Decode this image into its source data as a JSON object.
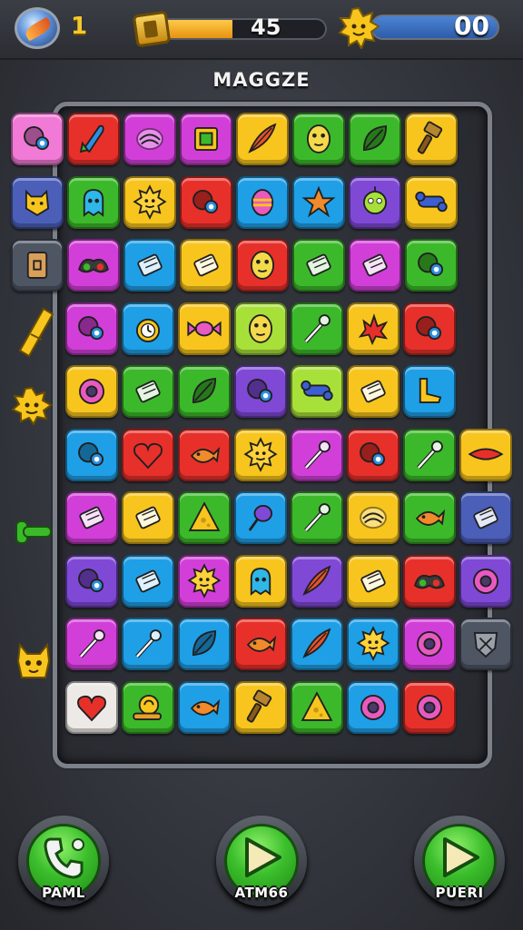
{
  "hud": {
    "level": "1",
    "progress": {
      "value": "45",
      "fill_fraction": 0.45
    },
    "score": "00"
  },
  "title": "MAGGZE",
  "colors": {
    "red": "#e8302b",
    "magenta": "#d23fd8",
    "yellow": "#f7c51d",
    "green": "#3cb92a",
    "blue": "#1f9fe6",
    "purple": "#7f49d6",
    "pink": "#f07ad6",
    "lime": "#a8e03a",
    "navy": "#4b5fb8",
    "gray": "#4e5664",
    "white": "#ece9e6"
  },
  "board": {
    "rows": [
      [
        "pink:blob",
        "red:rocket",
        "magenta:swirl",
        "magenta:box",
        "yellow:feather",
        "green:face",
        "green:leaf",
        "yellow:hammer"
      ],
      [
        "navy:cat",
        "green:ghost",
        "yellow:sun",
        "red:blob",
        "blue:egg",
        "blue:star",
        "purple:robot",
        "yellow:bone"
      ],
      [
        "gray:card",
        "magenta:mask",
        "blue:bar",
        "yellow:bar",
        "red:face",
        "green:bar",
        "magenta:bar",
        "green:blob"
      ],
      [
        "magenta:blob",
        "blue:clock",
        "yellow:candy",
        "lime:face",
        "green:wand",
        "yellow:splat",
        "red:blob"
      ],
      [
        "yellow:ring",
        "green:bar",
        "green:leaf",
        "purple:blob",
        "lime:bone",
        "yellow:bar",
        "blue:shoe"
      ],
      [
        "blue:blob",
        "red:heart",
        "red:fish",
        "yellow:sun",
        "magenta:wand",
        "red:blob",
        "green:wand",
        "yellow:lips"
      ],
      [
        "magenta:bar",
        "yellow:bar",
        "green:cheese",
        "blue:pin",
        "green:wand",
        "yellow:swirl",
        "green:fish",
        "navy:bar"
      ],
      [
        "purple:blob",
        "blue:bar",
        "magenta:sun",
        "yellow:ghost",
        "purple:feather",
        "yellow:bar",
        "red:mask",
        "purple:ring"
      ],
      [
        "magenta:wand",
        "blue:wand",
        "blue:leaf",
        "red:fish",
        "blue:feather",
        "blue:sun",
        "magenta:ring",
        "gray:shield"
      ],
      [
        "white:heart",
        "green:snail",
        "blue:fish",
        "yellow:hammer",
        "green:cheese",
        "blue:ring",
        "red:ring"
      ]
    ]
  },
  "side_items": [
    "candy-bar-icon",
    "sun-face-icon",
    "green-bone-icon",
    "cat-face-icon"
  ],
  "buttons": [
    {
      "label": "PAML",
      "icon": "phone-icon"
    },
    {
      "label": "ATM66",
      "icon": "play-icon"
    },
    {
      "label": "PUERI",
      "icon": "play-icon"
    }
  ]
}
